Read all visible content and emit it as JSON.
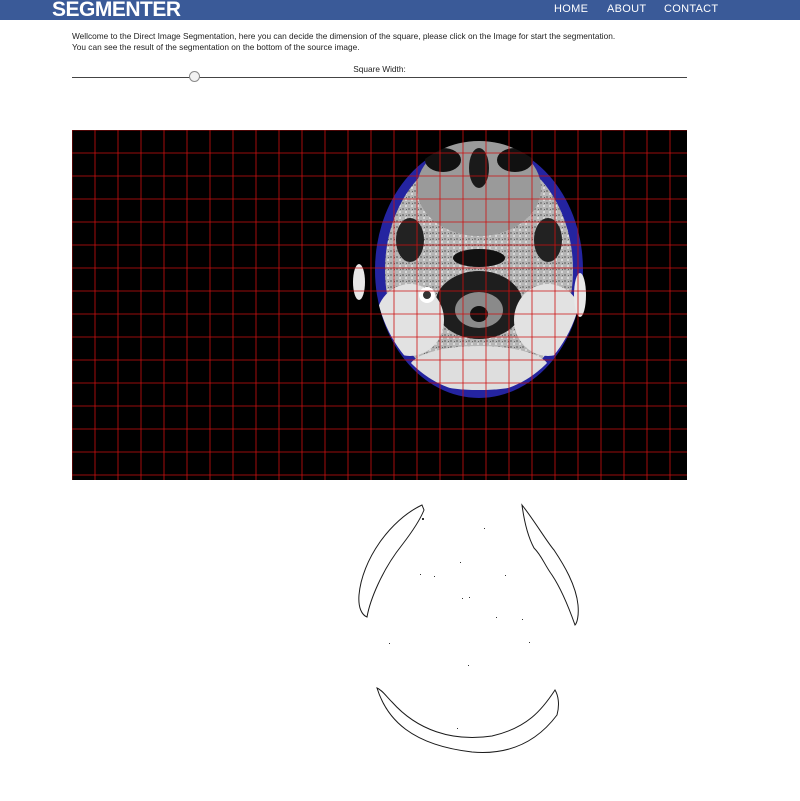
{
  "navbar": {
    "brand": "SEGMENTER",
    "items": [
      "HOME",
      "ABOUT",
      "CONTACT"
    ],
    "bg_color": "#3a5a98"
  },
  "intro": {
    "line1": "Wellcome to the Direct Image Segmentation, here you can decide the dimension of the square, please click on the Image for start the segmentation.",
    "line2": "You can see the result of the segmentation on the bottom of the source image."
  },
  "slider": {
    "label": "Square Width:",
    "value_fraction": 0.2
  },
  "source_image": {
    "description_icon": "mri-head-axial-scan",
    "grid_color": "#cc1111",
    "segmentation_color": "#2a2aa8"
  },
  "result_image": {
    "description_icon": "segmentation-contour-outline"
  }
}
